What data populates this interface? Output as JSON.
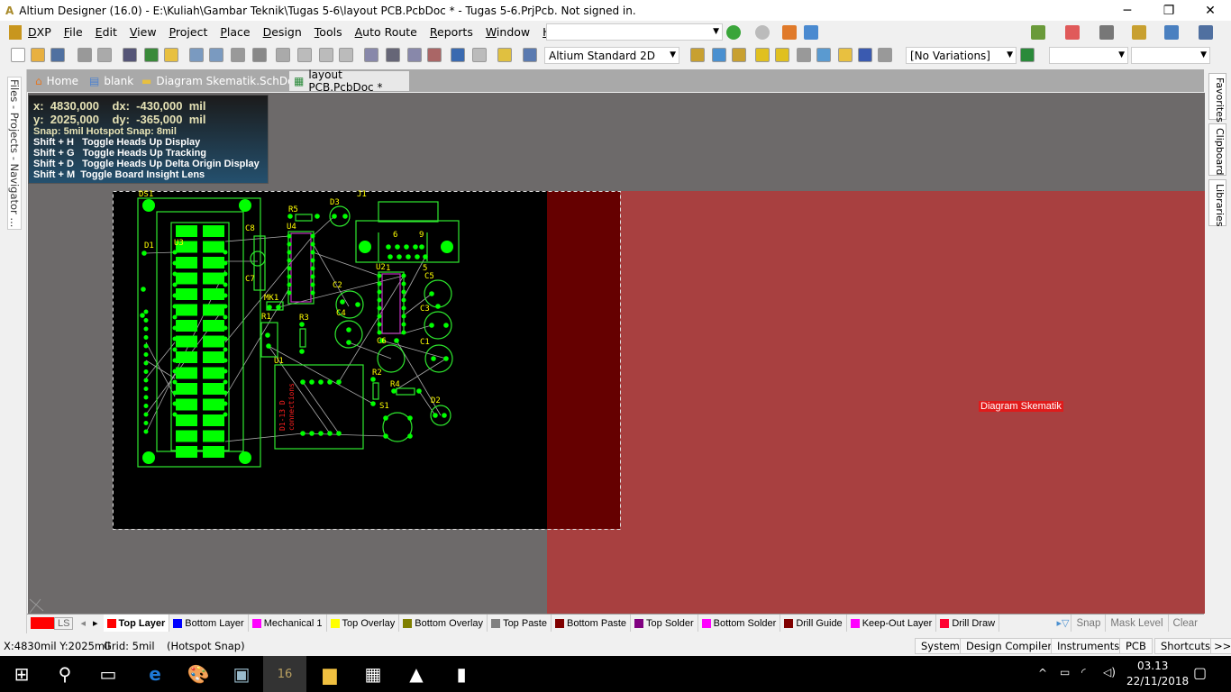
{
  "window": {
    "title": "Altium Designer (16.0) - E:\\Kuliah\\Gambar Teknik\\Tugas 5-6\\layout PCB.PcbDoc * - Tugas 5-6.PrjPcb. Not signed in.",
    "minimize": "─",
    "restore": "❐",
    "close": "✕"
  },
  "menu": [
    "DXP",
    "File",
    "Edit",
    "View",
    "Project",
    "Place",
    "Design",
    "Tools",
    "Auto Route",
    "Reports",
    "Window",
    "Help"
  ],
  "toolbar": {
    "view_config": "Altium Standard 2D",
    "variations": "[No Variations]",
    "address": "",
    "combo3": "",
    "combo4": ""
  },
  "doc_tabs": [
    {
      "label": "Home",
      "icon": "home-icon"
    },
    {
      "label": "blank",
      "icon": "document-icon"
    },
    {
      "label": "Diagram Skematik.SchDoc *",
      "icon": "schematic-icon"
    },
    {
      "label": "layout PCB.PcbDoc *",
      "icon": "pcb-icon",
      "active": true
    }
  ],
  "left_panel": "Files - Projects - Navigator ...",
  "right_panel": [
    "Favorites",
    "Clipboard",
    "Libraries"
  ],
  "hud": {
    "line1": "x:  4830,000    dx:  -430,000  mil",
    "line2": "y:  2025,000    dy:  -365,000  mil",
    "snap": "Snap: 5mil Hotspot Snap: 8mil",
    "shortcuts": [
      "Shift + H   Toggle Heads Up Display",
      "Shift + G   Toggle Heads Up Tracking",
      "Shift + D   Toggle Heads Up Delta Origin Display",
      "Shift + M  Toggle Board Insight Lens"
    ]
  },
  "room_label": "Diagram Skematik",
  "pcb": {
    "designators": [
      "DS1",
      "D1",
      "U3",
      "C8",
      "C7",
      "R5",
      "D3",
      "U4",
      "J1",
      "MK1",
      "R1",
      "R3",
      "C2",
      "C4",
      "U2",
      "C5",
      "C3",
      "C1",
      "C6",
      "U1",
      "R2",
      "R4",
      "S1",
      "D2",
      "6",
      "9",
      "1",
      "5"
    ],
    "silk_text": "D1-13 D\nconnections"
  },
  "layers": {
    "current_swatch": "#ff0000",
    "ls": "LS",
    "tabs": [
      {
        "label": "Top Layer",
        "color": "#ff0000",
        "active": true
      },
      {
        "label": "Bottom Layer",
        "color": "#0000ff"
      },
      {
        "label": "Mechanical 1",
        "color": "#ff00ff"
      },
      {
        "label": "Top Overlay",
        "color": "#ffff00"
      },
      {
        "label": "Bottom Overlay",
        "color": "#808000"
      },
      {
        "label": "Top Paste",
        "color": "#808080"
      },
      {
        "label": "Bottom Paste",
        "color": "#800000"
      },
      {
        "label": "Top Solder",
        "color": "#800080"
      },
      {
        "label": "Bottom Solder",
        "color": "#ff00ff"
      },
      {
        "label": "Drill Guide",
        "color": "#800000"
      },
      {
        "label": "Keep-Out Layer",
        "color": "#ff00ff"
      },
      {
        "label": "Drill Draw",
        "color": "#ff0030"
      }
    ],
    "buttons": [
      "Snap",
      "Mask Level",
      "Clear"
    ]
  },
  "status": {
    "coords": "X:4830mil Y:2025mil",
    "grid": "Grid: 5mil",
    "snap": "(Hotspot Snap)",
    "panels": [
      "System",
      "Design Compiler",
      "Instruments",
      "PCB",
      "Shortcuts",
      ">>"
    ]
  },
  "taskbar": {
    "time": "03.13",
    "date": "22/11/2018"
  },
  "colors": {
    "board": "#000000",
    "canvas": "#6d6a6a",
    "room": "#a84040",
    "silk": "#ffff00",
    "copper": "#00ff00"
  }
}
